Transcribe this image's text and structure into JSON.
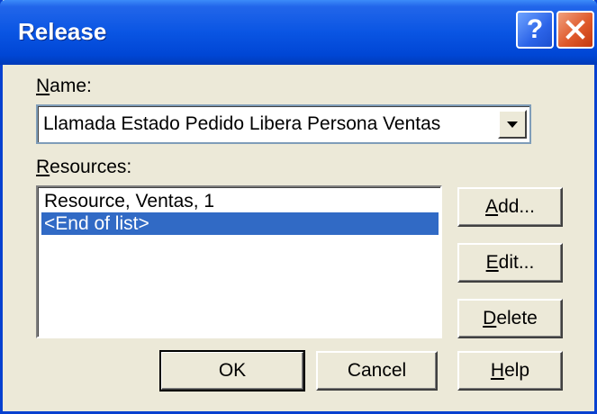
{
  "window": {
    "title": "Release",
    "help_glyph": "?",
    "close_glyph": "close-x"
  },
  "name_field": {
    "label": "Name:",
    "value": "Llamada Estado Pedido Libera Persona Ventas"
  },
  "resources": {
    "label": "Resources:",
    "items": [
      {
        "label": "Resource, Ventas, 1",
        "selected": false
      },
      {
        "label": "<End of list>",
        "selected": true
      }
    ]
  },
  "buttons": {
    "add": "Add...",
    "edit": "Edit...",
    "delete": "Delete",
    "ok": "OK",
    "cancel": "Cancel",
    "help": "Help"
  },
  "colors": {
    "title_bar": "#0a55e3",
    "selection": "#316ac5",
    "face": "#ece9d8",
    "close_button": "#df5a2c"
  }
}
